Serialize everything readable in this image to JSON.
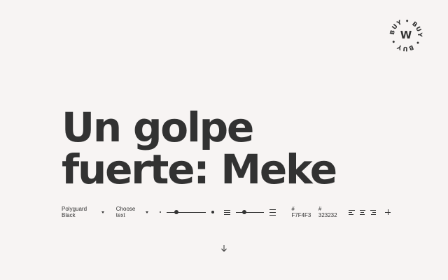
{
  "badge": {
    "ring_text": "BUY • BUY • BUY •",
    "letter": "W"
  },
  "hero": {
    "line1": "Un golpe",
    "line2": "fuerte: Meke"
  },
  "toolbar": {
    "font_select": "Polyguard Black",
    "text_select": "Choose text",
    "size_value": 0.25,
    "leading_value": 0.3,
    "background_color": "# F7F4F3",
    "text_color": "# 323232"
  },
  "colors": {
    "background": "#F7F4F3",
    "text": "#323232"
  },
  "icons": {
    "dropdown": "chevron-down-icon",
    "leading_small": "line-spacing-icon",
    "leading_large": "line-spacing-icon",
    "align_left": "align-left-icon",
    "align_center": "align-center-icon",
    "align_right": "align-right-icon",
    "add": "plus-icon",
    "scroll": "arrow-down-icon"
  }
}
